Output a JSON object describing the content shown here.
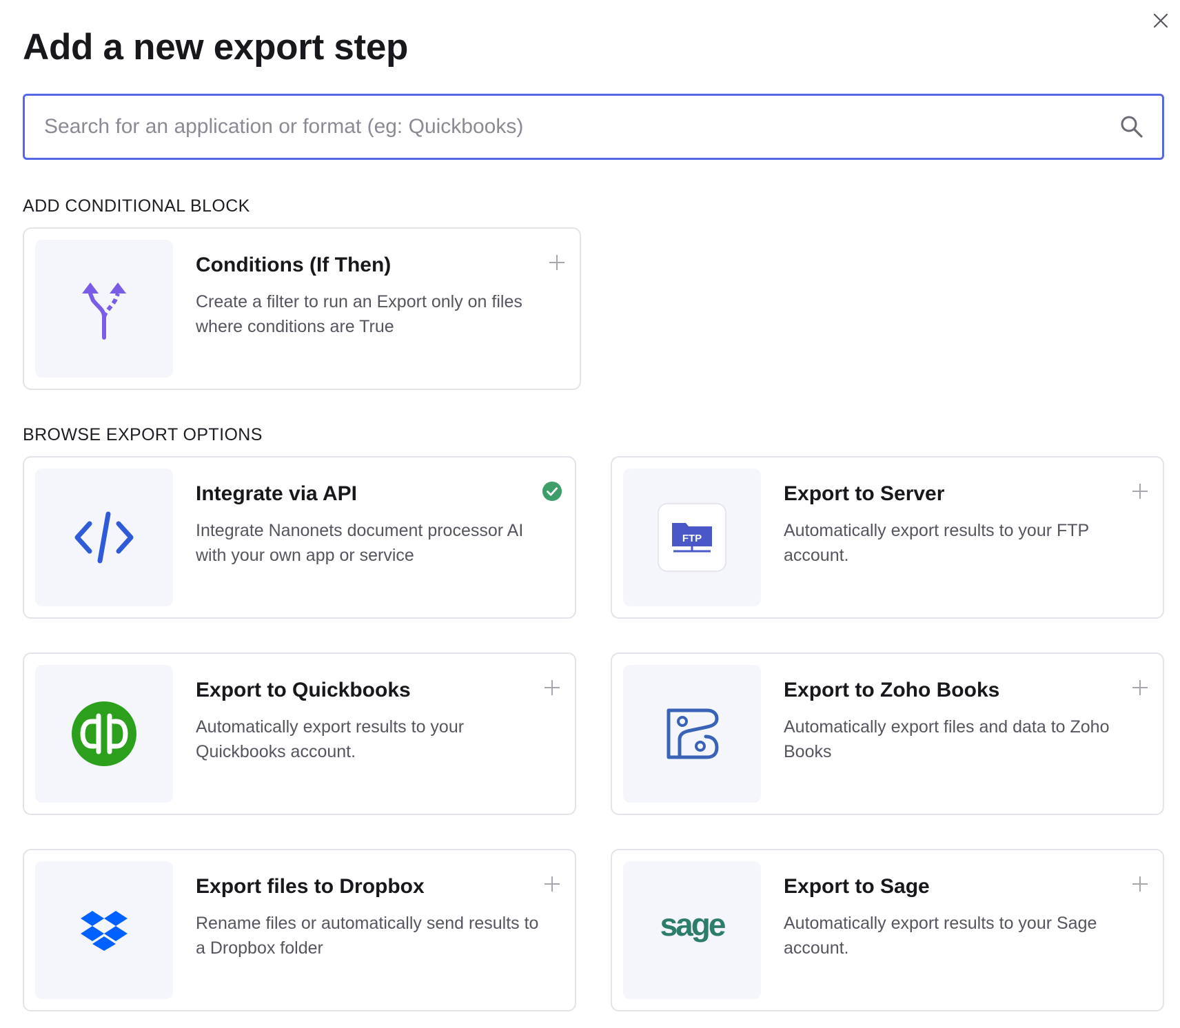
{
  "dialog": {
    "title": "Add a new export step"
  },
  "search": {
    "placeholder": "Search for an application or format (eg: Quickbooks)",
    "value": ""
  },
  "sections": {
    "conditional": "ADD CONDITIONAL BLOCK",
    "browse": "BROWSE EXPORT OPTIONS"
  },
  "cards": {
    "conditions": {
      "title": "Conditions (If Then)",
      "description": "Create a filter to run an Export only on files where conditions are True",
      "icon": "branch-icon",
      "action": "add"
    },
    "api": {
      "title": "Integrate via API",
      "description": "Integrate Nanonets document processor AI with your own app or service",
      "icon": "code-icon",
      "action": "added"
    },
    "server": {
      "title": "Export to Server",
      "description": "Automatically export results to your FTP account.",
      "icon": "ftp-icon",
      "icon_text": "FTP",
      "action": "add"
    },
    "quickbooks": {
      "title": "Export to Quickbooks",
      "description": "Automatically export results to your Quickbooks account.",
      "icon": "quickbooks-logo",
      "action": "add"
    },
    "zoho": {
      "title": "Export to Zoho Books",
      "description": "Automatically export files and data to Zoho Books",
      "icon": "zoho-books-logo",
      "action": "add"
    },
    "dropbox": {
      "title": "Export files to Dropbox",
      "description": "Rename files or automatically send results to a Dropbox folder",
      "icon": "dropbox-logo",
      "action": "add"
    },
    "sage": {
      "title": "Export to Sage",
      "description": "Automatically export results to your Sage account.",
      "icon": "sage-logo",
      "icon_text": "sage",
      "action": "add"
    }
  },
  "colors": {
    "accent": "#5468e6",
    "icon_bg": "#f5f6fc",
    "card_border": "#e3e4e9",
    "check_green": "#3e9e6a",
    "quickbooks_green": "#2ca01c",
    "dropbox_blue": "#0061fe",
    "sage_green": "#2e7d6b",
    "branch_purple": "#7b5ce6",
    "code_blue": "#2f5bd8"
  }
}
